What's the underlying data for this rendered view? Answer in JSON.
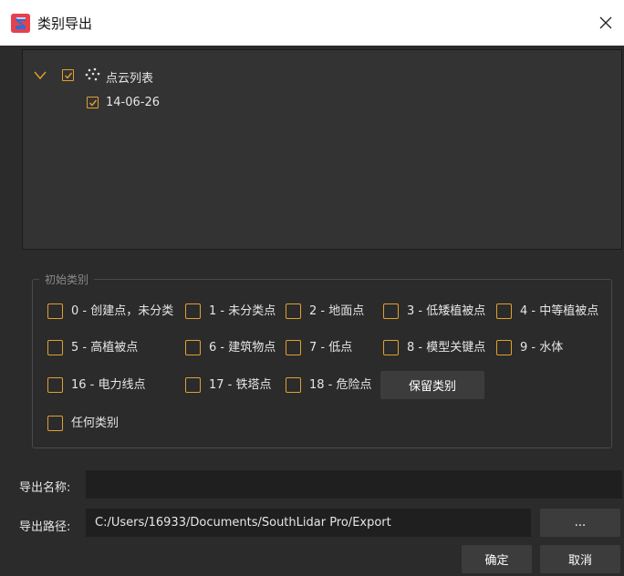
{
  "window": {
    "title": "类别导出"
  },
  "tree": {
    "root_label": "点云列表",
    "root_checked": true,
    "children": [
      {
        "label": "14-06-26",
        "checked": true
      }
    ]
  },
  "classes": {
    "group_title": "初始类别",
    "items": [
      "0 - 创建点，未分类",
      "1 - 未分类点",
      "2 - 地面点",
      "3 - 低矮植被点",
      "4 - 中等植被点",
      "5 - 高植被点",
      "6 - 建筑物点",
      "7 - 低点",
      "8 - 模型关键点",
      "9 - 水体",
      "16 - 电力线点",
      "17 - 铁塔点",
      "18 - 危险点",
      "任何类别"
    ],
    "keep_button": "保留类别"
  },
  "export": {
    "name_label": "导出名称:",
    "name_value": "",
    "path_label": "导出路径:",
    "path_value": "C:/Users/16933/Documents/SouthLidar Pro/Export",
    "browse_button": "...",
    "ok_button": "确定",
    "cancel_button": "取消"
  },
  "colors": {
    "accent": "#e0a030",
    "background": "#2b2b2b",
    "panel": "#333333"
  }
}
